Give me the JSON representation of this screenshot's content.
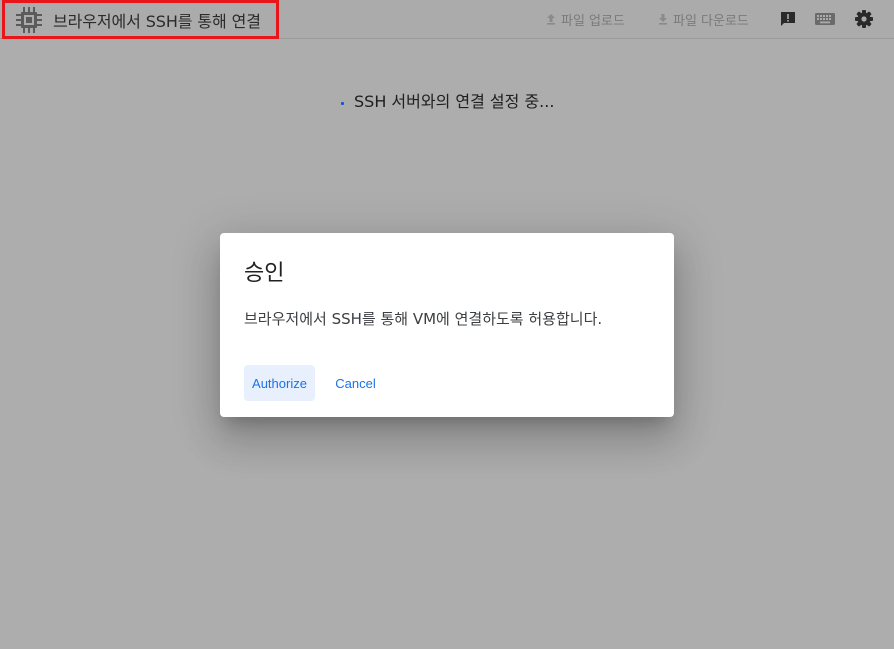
{
  "header": {
    "title": "브라우저에서 SSH를 통해 연결",
    "upload_label": "파일 업로드",
    "download_label": "파일 다운로드"
  },
  "icons": {
    "app": "cpu-chip-icon",
    "upload": "upload-icon",
    "download": "download-icon",
    "feedback": "feedback-icon",
    "keyboard": "keyboard-icon",
    "settings": "gear-icon"
  },
  "status": {
    "text": "SSH 서버와의 연결 설정 중..."
  },
  "dialog": {
    "title": "승인",
    "body": "브라우저에서 SSH를 통해 VM에 연결하도록 허용합니다.",
    "authorize_label": "Authorize",
    "cancel_label": "Cancel"
  },
  "colors": {
    "highlight_border": "#e8151a",
    "primary_button_text": "#1a73e8",
    "primary_button_bg": "#e8f0fe",
    "overlay": "#adadad"
  }
}
